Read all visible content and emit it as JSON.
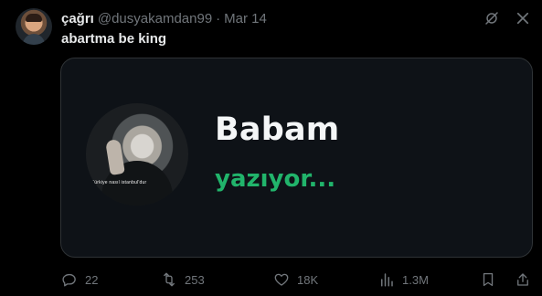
{
  "tweet": {
    "author_name": "çağrı",
    "handle": "@dusyakamdan99",
    "separator": "·",
    "date": "Mar 14",
    "text": "abartma be king"
  },
  "media": {
    "photo_caption": "Türkiye nasıl istanbul'dur",
    "title": "Babam",
    "status": "yazıyor...",
    "status_color": "#21b46b"
  },
  "actions": {
    "replies": "22",
    "reposts": "253",
    "likes": "18K",
    "views": "1.3M"
  },
  "icons": {
    "top": [
      "grok-icon",
      "close-icon"
    ],
    "bottom": [
      "reply-icon",
      "retweet-icon",
      "heart-icon",
      "views-icon",
      "bookmark-icon",
      "share-icon"
    ]
  },
  "colors": {
    "background": "#000000",
    "text": "#e7e9ea",
    "muted": "#71767b",
    "border": "#2f3336"
  }
}
